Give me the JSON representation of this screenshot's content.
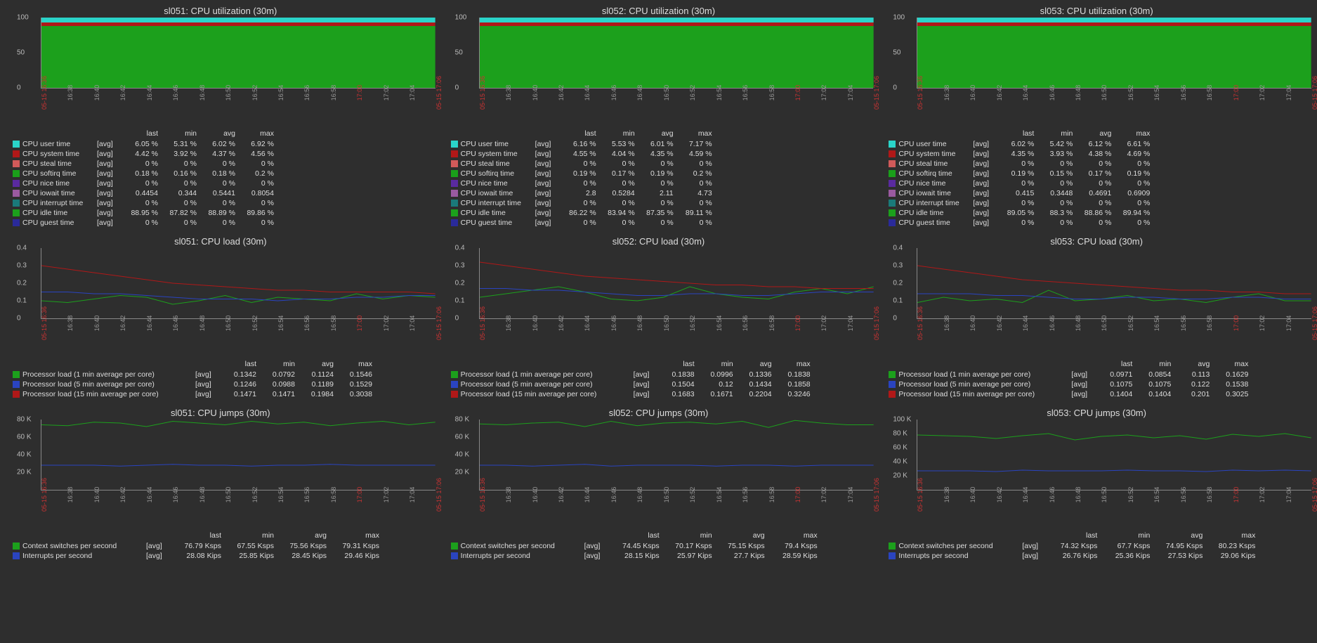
{
  "hosts": [
    "sl051",
    "sl052",
    "sl053"
  ],
  "time_ticks": [
    "05-15 16:36",
    "16:38",
    "16:40",
    "16:42",
    "16:44",
    "16:46",
    "16:48",
    "16:50",
    "16:52",
    "16:54",
    "16:56",
    "16:58",
    "17:00",
    "17:02",
    "17:04",
    "05-15 17:06"
  ],
  "time_ticks_red": [
    0,
    12,
    15
  ],
  "chart_data": {
    "cpu_util_ymax": 100,
    "cpu_util_yticks": [
      0,
      50,
      100
    ],
    "cpu_load_yticks": [
      0,
      0.1,
      0.2,
      0.3,
      0.4
    ],
    "cpu_jumps_yticks_std": [
      "20 K",
      "40 K",
      "60 K",
      "80 K"
    ],
    "cpu_jumps_yticks_alt": [
      "20 K",
      "40 K",
      "60 K",
      "80 K",
      "100 K"
    ],
    "sl051": {
      "cpu_util": {
        "title": "sl051: CPU utilization (30m)",
        "series_colors": {
          "user": "#2ad4c9",
          "system": "#b01818",
          "steal": "#d15a5a",
          "softirq": "#1aa01a",
          "nice": "#5a2aa0",
          "iowait": "#9a5aa0",
          "interrupt": "#1a7a7a",
          "idle": "#1ca01c",
          "guest": "#2a2a9a"
        },
        "headers": [
          "last",
          "min",
          "avg",
          "max"
        ],
        "rows": [
          {
            "swatch": "#2ad4c9",
            "label": "CPU user time",
            "agg": "[avg]",
            "last": "6.05 %",
            "min": "5.31 %",
            "avg": "6.02 %",
            "max": "6.92 %"
          },
          {
            "swatch": "#b01818",
            "label": "CPU system time",
            "agg": "[avg]",
            "last": "4.42 %",
            "min": "3.92 %",
            "avg": "4.37 %",
            "max": "4.56 %"
          },
          {
            "swatch": "#d15a5a",
            "label": "CPU steal time",
            "agg": "[avg]",
            "last": "0 %",
            "min": "0 %",
            "avg": "0 %",
            "max": "0 %"
          },
          {
            "swatch": "#1aa01a",
            "label": "CPU softirq time",
            "agg": "[avg]",
            "last": "0.18 %",
            "min": "0.16 %",
            "avg": "0.18 %",
            "max": "0.2 %"
          },
          {
            "swatch": "#5a2aa0",
            "label": "CPU nice time",
            "agg": "[avg]",
            "last": "0 %",
            "min": "0 %",
            "avg": "0 %",
            "max": "0 %"
          },
          {
            "swatch": "#9a5aa0",
            "label": "CPU iowait time",
            "agg": "[avg]",
            "last": "0.4454",
            "min": "0.344",
            "avg": "0.5441",
            "max": "0.8054"
          },
          {
            "swatch": "#1a7a7a",
            "label": "CPU interrupt time",
            "agg": "[avg]",
            "last": "0 %",
            "min": "0 %",
            "avg": "0 %",
            "max": "0 %"
          },
          {
            "swatch": "#1ca01c",
            "label": "CPU idle time",
            "agg": "[avg]",
            "last": "88.95 %",
            "min": "87.82 %",
            "avg": "88.89 %",
            "max": "89.86 %"
          },
          {
            "swatch": "#2a2a9a",
            "label": "CPU guest time",
            "agg": "[avg]",
            "last": "0 %",
            "min": "0 %",
            "avg": "0 %",
            "max": "0 %"
          }
        ]
      },
      "cpu_load": {
        "title": "sl051: CPU load (30m)",
        "headers": [
          "last",
          "min",
          "avg",
          "max"
        ],
        "lines": {
          "1m": [
            0.1,
            0.09,
            0.11,
            0.13,
            0.12,
            0.08,
            0.1,
            0.13,
            0.09,
            0.12,
            0.11,
            0.1,
            0.14,
            0.11,
            0.13,
            0.12
          ],
          "5m": [
            0.15,
            0.15,
            0.14,
            0.14,
            0.13,
            0.12,
            0.11,
            0.11,
            0.11,
            0.1,
            0.11,
            0.11,
            0.12,
            0.12,
            0.13,
            0.13
          ],
          "15m": [
            0.3,
            0.28,
            0.26,
            0.24,
            0.22,
            0.2,
            0.19,
            0.18,
            0.17,
            0.16,
            0.16,
            0.15,
            0.15,
            0.15,
            0.15,
            0.14
          ]
        },
        "rows": [
          {
            "swatch": "#1ca01c",
            "label": "Processor load (1 min average per core)",
            "agg": "[avg]",
            "last": "0.1342",
            "min": "0.0792",
            "avg": "0.1124",
            "max": "0.1546"
          },
          {
            "swatch": "#2a44c0",
            "label": "Processor load (5 min average per core)",
            "agg": "[avg]",
            "last": "0.1246",
            "min": "0.0988",
            "avg": "0.1189",
            "max": "0.1529"
          },
          {
            "swatch": "#b01818",
            "label": "Processor load (15 min average per core)",
            "agg": "[avg]",
            "last": "0.1471",
            "min": "0.1471",
            "avg": "0.1984",
            "max": "0.3038"
          }
        ]
      },
      "cpu_jumps": {
        "title": "sl051: CPU jumps (30m)",
        "ymax": 80,
        "lines": {
          "ctx": [
            74,
            73,
            77,
            76,
            72,
            78,
            76,
            74,
            78,
            75,
            77,
            73,
            76,
            78,
            74,
            77
          ],
          "int": [
            28,
            28,
            28,
            27,
            28,
            29,
            28,
            28,
            27,
            28,
            28,
            29,
            28,
            28,
            28,
            28
          ]
        },
        "headers": [
          "last",
          "min",
          "avg",
          "max"
        ],
        "rows": [
          {
            "swatch": "#1ca01c",
            "label": "Context switches per second",
            "agg": "[avg]",
            "last": "76.79 Ksps",
            "min": "67.55 Ksps",
            "avg": "75.56 Ksps",
            "max": "79.31 Ksps"
          },
          {
            "swatch": "#2a44c0",
            "label": "Interrupts per second",
            "agg": "[avg]",
            "last": "28.08 Kips",
            "min": "25.85 Kips",
            "avg": "28.45 Kips",
            "max": "29.46 Kips"
          }
        ]
      }
    },
    "sl052": {
      "cpu_util": {
        "title": "sl052: CPU utilization (30m)",
        "headers": [
          "last",
          "min",
          "avg",
          "max"
        ],
        "rows": [
          {
            "swatch": "#2ad4c9",
            "label": "CPU user time",
            "agg": "[avg]",
            "last": "6.16 %",
            "min": "5.53 %",
            "avg": "6.01 %",
            "max": "7.17 %"
          },
          {
            "swatch": "#b01818",
            "label": "CPU system time",
            "agg": "[avg]",
            "last": "4.55 %",
            "min": "4.04 %",
            "avg": "4.35 %",
            "max": "4.59 %"
          },
          {
            "swatch": "#d15a5a",
            "label": "CPU steal time",
            "agg": "[avg]",
            "last": "0 %",
            "min": "0 %",
            "avg": "0 %",
            "max": "0 %"
          },
          {
            "swatch": "#1aa01a",
            "label": "CPU softirq time",
            "agg": "[avg]",
            "last": "0.19 %",
            "min": "0.17 %",
            "avg": "0.19 %",
            "max": "0.2 %"
          },
          {
            "swatch": "#5a2aa0",
            "label": "CPU nice time",
            "agg": "[avg]",
            "last": "0 %",
            "min": "0 %",
            "avg": "0 %",
            "max": "0 %"
          },
          {
            "swatch": "#9a5aa0",
            "label": "CPU iowait time",
            "agg": "[avg]",
            "last": "2.8",
            "min": "0.5284",
            "avg": "2.11",
            "max": "4.73"
          },
          {
            "swatch": "#1a7a7a",
            "label": "CPU interrupt time",
            "agg": "[avg]",
            "last": "0 %",
            "min": "0 %",
            "avg": "0 %",
            "max": "0 %"
          },
          {
            "swatch": "#1ca01c",
            "label": "CPU idle time",
            "agg": "[avg]",
            "last": "86.22 %",
            "min": "83.94 %",
            "avg": "87.35 %",
            "max": "89.11 %"
          },
          {
            "swatch": "#2a2a9a",
            "label": "CPU guest time",
            "agg": "[avg]",
            "last": "0 %",
            "min": "0 %",
            "avg": "0 %",
            "max": "0 %"
          }
        ]
      },
      "cpu_load": {
        "title": "sl052: CPU load (30m)",
        "headers": [
          "last",
          "min",
          "avg",
          "max"
        ],
        "lines": {
          "1m": [
            0.12,
            0.14,
            0.16,
            0.18,
            0.15,
            0.11,
            0.1,
            0.12,
            0.18,
            0.14,
            0.12,
            0.11,
            0.15,
            0.17,
            0.14,
            0.18
          ],
          "5m": [
            0.17,
            0.17,
            0.16,
            0.16,
            0.15,
            0.14,
            0.13,
            0.13,
            0.14,
            0.14,
            0.13,
            0.13,
            0.14,
            0.15,
            0.15,
            0.15
          ],
          "15m": [
            0.32,
            0.3,
            0.28,
            0.26,
            0.24,
            0.23,
            0.22,
            0.21,
            0.2,
            0.19,
            0.19,
            0.18,
            0.18,
            0.17,
            0.17,
            0.17
          ]
        },
        "rows": [
          {
            "swatch": "#1ca01c",
            "label": "Processor load (1 min average per core)",
            "agg": "[avg]",
            "last": "0.1838",
            "min": "0.0996",
            "avg": "0.1336",
            "max": "0.1838"
          },
          {
            "swatch": "#2a44c0",
            "label": "Processor load (5 min average per core)",
            "agg": "[avg]",
            "last": "0.1504",
            "min": "0.12",
            "avg": "0.1434",
            "max": "0.1858"
          },
          {
            "swatch": "#b01818",
            "label": "Processor load (15 min average per core)",
            "agg": "[avg]",
            "last": "0.1683",
            "min": "0.1671",
            "avg": "0.2204",
            "max": "0.3246"
          }
        ]
      },
      "cpu_jumps": {
        "title": "sl052: CPU jumps (30m)",
        "ymax": 80,
        "lines": {
          "ctx": [
            75,
            74,
            76,
            77,
            72,
            78,
            73,
            76,
            77,
            75,
            78,
            71,
            79,
            76,
            74,
            74
          ],
          "int": [
            28,
            28,
            27,
            28,
            29,
            27,
            28,
            28,
            28,
            27,
            28,
            28,
            27,
            28,
            28,
            28
          ]
        },
        "headers": [
          "last",
          "min",
          "avg",
          "max"
        ],
        "rows": [
          {
            "swatch": "#1ca01c",
            "label": "Context switches per second",
            "agg": "[avg]",
            "last": "74.45 Ksps",
            "min": "70.17 Ksps",
            "avg": "75.15 Ksps",
            "max": "79.4 Ksps"
          },
          {
            "swatch": "#2a44c0",
            "label": "Interrupts per second",
            "agg": "[avg]",
            "last": "28.15 Kips",
            "min": "25.97 Kips",
            "avg": "27.7 Kips",
            "max": "28.59 Kips"
          }
        ]
      }
    },
    "sl053": {
      "cpu_util": {
        "title": "sl053: CPU utilization (30m)",
        "headers": [
          "last",
          "min",
          "avg",
          "max"
        ],
        "rows": [
          {
            "swatch": "#2ad4c9",
            "label": "CPU user time",
            "agg": "[avg]",
            "last": "6.02 %",
            "min": "5.42 %",
            "avg": "6.12 %",
            "max": "6.61 %"
          },
          {
            "swatch": "#b01818",
            "label": "CPU system time",
            "agg": "[avg]",
            "last": "4.35 %",
            "min": "3.93 %",
            "avg": "4.38 %",
            "max": "4.69 %"
          },
          {
            "swatch": "#d15a5a",
            "label": "CPU steal time",
            "agg": "[avg]",
            "last": "0 %",
            "min": "0 %",
            "avg": "0 %",
            "max": "0 %"
          },
          {
            "swatch": "#1aa01a",
            "label": "CPU softirq time",
            "agg": "[avg]",
            "last": "0.19 %",
            "min": "0.15 %",
            "avg": "0.17 %",
            "max": "0.19 %"
          },
          {
            "swatch": "#5a2aa0",
            "label": "CPU nice time",
            "agg": "[avg]",
            "last": "0 %",
            "min": "0 %",
            "avg": "0 %",
            "max": "0 %"
          },
          {
            "swatch": "#9a5aa0",
            "label": "CPU iowait time",
            "agg": "[avg]",
            "last": "0.415",
            "min": "0.3448",
            "avg": "0.4691",
            "max": "0.6909"
          },
          {
            "swatch": "#1a7a7a",
            "label": "CPU interrupt time",
            "agg": "[avg]",
            "last": "0 %",
            "min": "0 %",
            "avg": "0 %",
            "max": "0 %"
          },
          {
            "swatch": "#1ca01c",
            "label": "CPU idle time",
            "agg": "[avg]",
            "last": "89.05 %",
            "min": "88.3 %",
            "avg": "88.86 %",
            "max": "89.94 %"
          },
          {
            "swatch": "#2a2a9a",
            "label": "CPU guest time",
            "agg": "[avg]",
            "last": "0 %",
            "min": "0 %",
            "avg": "0 %",
            "max": "0 %"
          }
        ]
      },
      "cpu_load": {
        "title": "sl053: CPU load (30m)",
        "headers": [
          "last",
          "min",
          "avg",
          "max"
        ],
        "lines": {
          "1m": [
            0.09,
            0.12,
            0.1,
            0.11,
            0.09,
            0.16,
            0.1,
            0.11,
            0.13,
            0.1,
            0.11,
            0.09,
            0.12,
            0.14,
            0.1,
            0.1
          ],
          "5m": [
            0.14,
            0.14,
            0.14,
            0.13,
            0.13,
            0.12,
            0.11,
            0.11,
            0.12,
            0.12,
            0.11,
            0.11,
            0.12,
            0.12,
            0.11,
            0.11
          ],
          "15m": [
            0.3,
            0.28,
            0.26,
            0.24,
            0.22,
            0.21,
            0.2,
            0.19,
            0.18,
            0.17,
            0.16,
            0.16,
            0.15,
            0.15,
            0.14,
            0.14
          ]
        },
        "rows": [
          {
            "swatch": "#1ca01c",
            "label": "Processor load (1 min average per core)",
            "agg": "[avg]",
            "last": "0.0971",
            "min": "0.0854",
            "avg": "0.113",
            "max": "0.1629"
          },
          {
            "swatch": "#2a44c0",
            "label": "Processor load (5 min average per core)",
            "agg": "[avg]",
            "last": "0.1075",
            "min": "0.1075",
            "avg": "0.122",
            "max": "0.1538"
          },
          {
            "swatch": "#b01818",
            "label": "Processor load (15 min average per core)",
            "agg": "[avg]",
            "last": "0.1404",
            "min": "0.1404",
            "avg": "0.201",
            "max": "0.3025"
          }
        ]
      },
      "cpu_jumps": {
        "title": "sl053: CPU jumps (30m)",
        "ymax": 100,
        "lines": {
          "ctx": [
            78,
            77,
            76,
            73,
            77,
            80,
            71,
            76,
            78,
            74,
            77,
            72,
            79,
            76,
            80,
            74
          ],
          "int": [
            27,
            27,
            27,
            26,
            28,
            27,
            27,
            27,
            28,
            27,
            27,
            26,
            28,
            27,
            28,
            27
          ]
        },
        "headers": [
          "last",
          "min",
          "avg",
          "max"
        ],
        "rows": [
          {
            "swatch": "#1ca01c",
            "label": "Context switches per second",
            "agg": "[avg]",
            "last": "74.32 Ksps",
            "min": "67.7 Ksps",
            "avg": "74.95 Ksps",
            "max": "80.23 Ksps"
          },
          {
            "swatch": "#2a44c0",
            "label": "Interrupts per second",
            "agg": "[avg]",
            "last": "26.76 Kips",
            "min": "25.36 Kips",
            "avg": "27.53 Kips",
            "max": "29.06 Kips"
          }
        ]
      }
    }
  }
}
